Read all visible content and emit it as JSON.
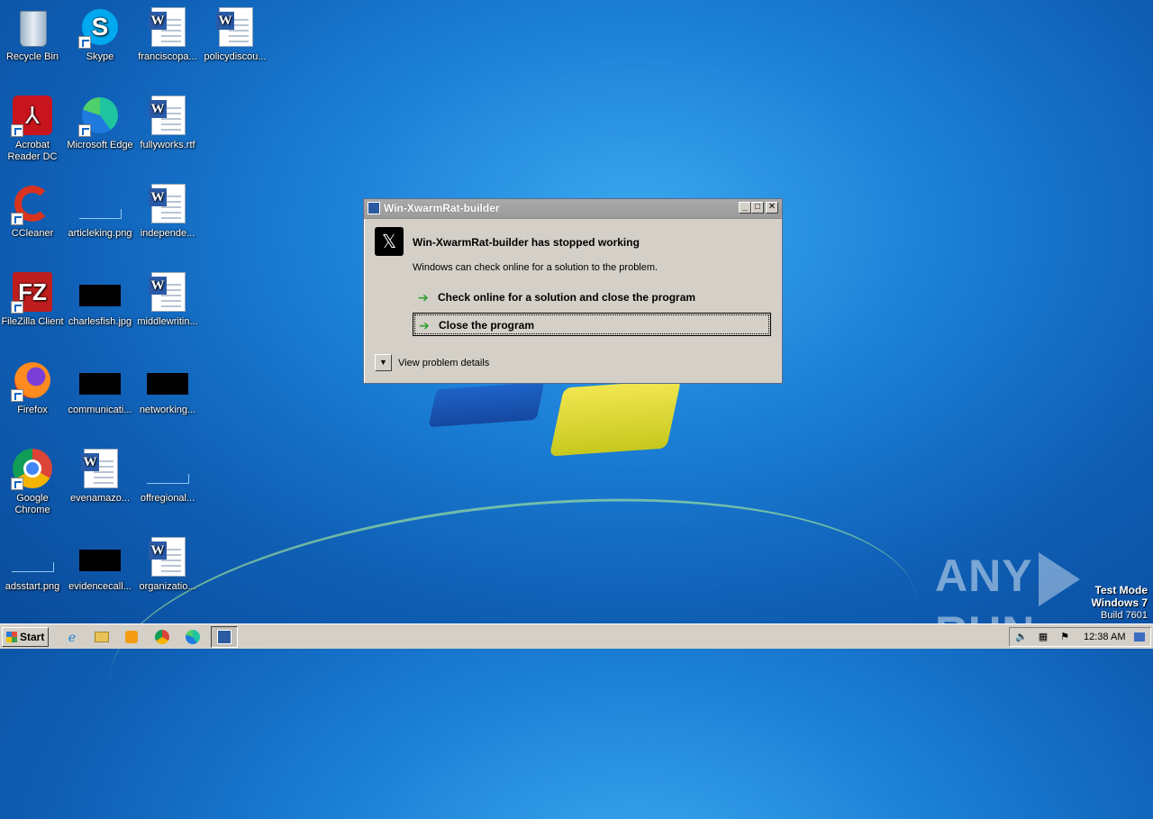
{
  "desktop": {
    "icons": [
      {
        "label": "Recycle Bin"
      },
      {
        "label": "Skype"
      },
      {
        "label": "franciscopa..."
      },
      {
        "label": "policydiscou..."
      },
      {
        "label": "Acrobat Reader DC"
      },
      {
        "label": "Microsoft Edge"
      },
      {
        "label": "fullyworks.rtf"
      },
      {
        "label": "CCleaner"
      },
      {
        "label": "articleking.png"
      },
      {
        "label": "independe..."
      },
      {
        "label": "FileZilla Client"
      },
      {
        "label": "charlesfish.jpg"
      },
      {
        "label": "middlewritin..."
      },
      {
        "label": "Firefox"
      },
      {
        "label": "communicati..."
      },
      {
        "label": "networking..."
      },
      {
        "label": "Google Chrome"
      },
      {
        "label": "evenamazo..."
      },
      {
        "label": "offregional..."
      },
      {
        "label": "adsstart.png"
      },
      {
        "label": "evidencecall..."
      },
      {
        "label": "organizatio..."
      }
    ]
  },
  "dialog": {
    "title": "Win-XwarmRat-builder",
    "heading": "Win-XwarmRat-builder has stopped working",
    "subtext": "Windows can check online for a solution to the problem.",
    "option_check": "Check online for a solution and close the program",
    "option_close": "Close the program",
    "details": "View problem details",
    "btn_min": "_",
    "btn_max": "□",
    "btn_close": "✕",
    "app_glyph": "𝕏"
  },
  "watermark": {
    "left": "ANY",
    "right": "RUN",
    "mode": "Test Mode",
    "os": "Windows 7",
    "build": "Build 7601"
  },
  "taskbar": {
    "start_label": "Start",
    "clock": "12:38 AM"
  },
  "colors": {
    "accent_green": "#2e9e2e",
    "desktop_blue": "#1b7fd6"
  }
}
